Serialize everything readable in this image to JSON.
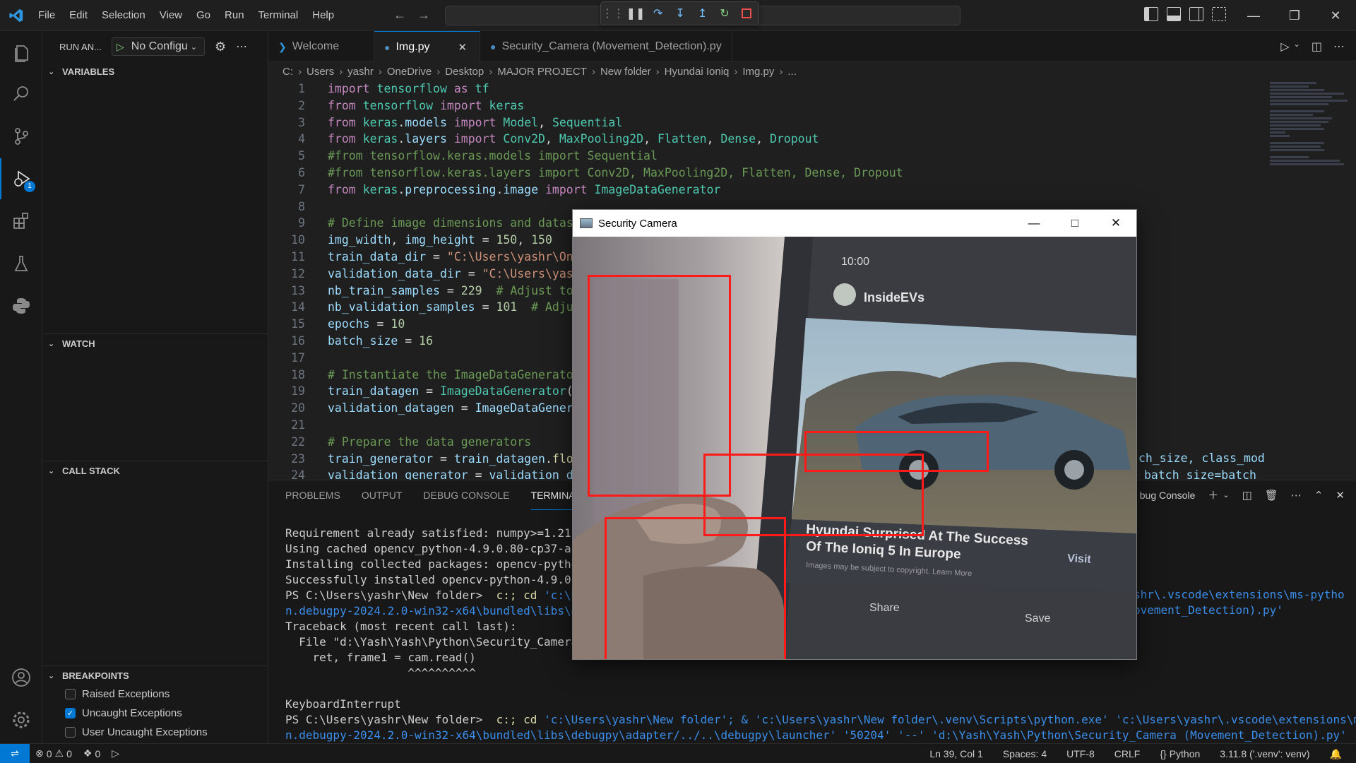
{
  "menu": [
    "File",
    "Edit",
    "Selection",
    "View",
    "Go",
    "Run",
    "Terminal",
    "Help"
  ],
  "sidebar": {
    "title": "RUN AN...",
    "config_label": "No Configu",
    "sections": {
      "variables": "VARIABLES",
      "watch": "WATCH",
      "call_stack": "CALL STACK",
      "breakpoints": "BREAKPOINTS"
    },
    "breakpoints": [
      {
        "label": "Raised Exceptions",
        "checked": false
      },
      {
        "label": "Uncaught Exceptions",
        "checked": true
      },
      {
        "label": "User Uncaught Exceptions",
        "checked": false
      }
    ]
  },
  "tabs": [
    {
      "label": "Welcome",
      "active": false
    },
    {
      "label": "Img.py",
      "active": true
    },
    {
      "label": "Security_Camera (Movement_Detection).py",
      "active": false
    }
  ],
  "breadcrumb": [
    "C:",
    "Users",
    "yashr",
    "OneDrive",
    "Desktop",
    "MAJOR PROJECT",
    "New folder",
    "Hyundai Ioniq",
    "Img.py",
    "..."
  ],
  "code_lines": [
    "import tensorflow as tf",
    "from tensorflow import keras",
    "from keras.models import Model, Sequential",
    "from keras.layers import Conv2D, MaxPooling2D, Flatten, Dense, Dropout",
    "#from tensorflow.keras.models import Sequential",
    "#from tensorflow.keras.layers import Conv2D, MaxPooling2D, Flatten, Dense, Dropout",
    "from keras.preprocessing.image import ImageDataGenerator",
    "",
    "# Define image dimensions and datase",
    "img_width, img_height = 150, 150",
    "train_data_dir = \"C:\\Users\\yashr\\One",
    "validation_data_dir = \"C:\\Users\\yash",
    "nb_train_samples = 229  # Adjust to",
    "nb_validation_samples = 101  # Adjus",
    "epochs = 10",
    "batch_size = 16",
    "",
    "# Instantiate the ImageDataGenerator",
    "train_datagen = ImageDataGenerator(r",
    "validation_datagen = ImageDataGenera",
    "",
    "# Prepare the data generators",
    "train_generator = train_datagen.flow",
    "validation_generator = validation_da"
  ],
  "code_overflow": {
    "line23_tail": "ch_size, class_mod",
    "line24_tail": "batch_size=batch"
  },
  "panel": {
    "tabs": [
      "PROBLEMS",
      "OUTPUT",
      "DEBUG CONSOLE",
      "TERMINAL"
    ],
    "active_tab": "TERMINAL",
    "right_label": "bug Console"
  },
  "terminal_lines": [
    "Requirement already satisfied: numpy>=1.21.2",
    "Using cached opencv_python-4.9.0.80-cp37-abi3",
    "Installing collected packages: opencv-python",
    "Successfully installed opencv-python-4.9.0.80",
    "PS C:\\Users\\yashr\\New folder>  c:; cd 'c:\\Use",
    "n.debugpy-2024.2.0-win32-x64\\bundled\\libs\\deb",
    "Traceback (most recent call last):",
    "  File \"d:\\Yash\\Yash\\Python\\Security_Camera (",
    "    ret, frame1 = cam.read()",
    "                  ^^^^^^^^^^",
    "KeyboardInterrupt",
    "PS C:\\Users\\yashr\\New folder>  c:; cd 'c:\\Users\\yashr\\New folder'; & 'c:\\Users\\yashr\\New folder\\.venv\\Scripts\\python.exe' 'c:\\Users\\yashr\\.vscode\\extensions\\ms-pytho",
    "n.debugpy-2024.2.0-win32-x64\\bundled\\libs\\debugpy\\adapter/../..\\debugpy\\launcher' '50204' '--' 'd:\\Yash\\Yash\\Python\\Security_Camera (Movement_Detection).py'"
  ],
  "terminal_right": [
    "shr\\.vscode\\extensions\\ms-pytho",
    "ovement_Detection).py'"
  ],
  "camera_window": {
    "title": "Security Camera",
    "phone_time": "10:00",
    "phone_app": "InsideEVs",
    "article_title_1": "Hyundai Surprised At The Success",
    "article_title_2": "Of The Ioniq 5 In Europe",
    "article_sub": "Images may be subject to copyright. Learn More",
    "visit_label": "Visit",
    "share_label": "Share",
    "save_label": "Save"
  },
  "status": {
    "errors": "0",
    "warnings": "0",
    "ports": "0",
    "position": "Ln 39, Col 1",
    "spaces": "Spaces: 4",
    "encoding": "UTF-8",
    "eol": "CRLF",
    "language": "Python",
    "interpreter": "3.11.8 ('.venv': venv)"
  },
  "colors": {
    "accent": "#0078d4",
    "detection_box": "#ff1a1a",
    "run_green": "#89d185",
    "stop_red": "#f14c4c"
  }
}
